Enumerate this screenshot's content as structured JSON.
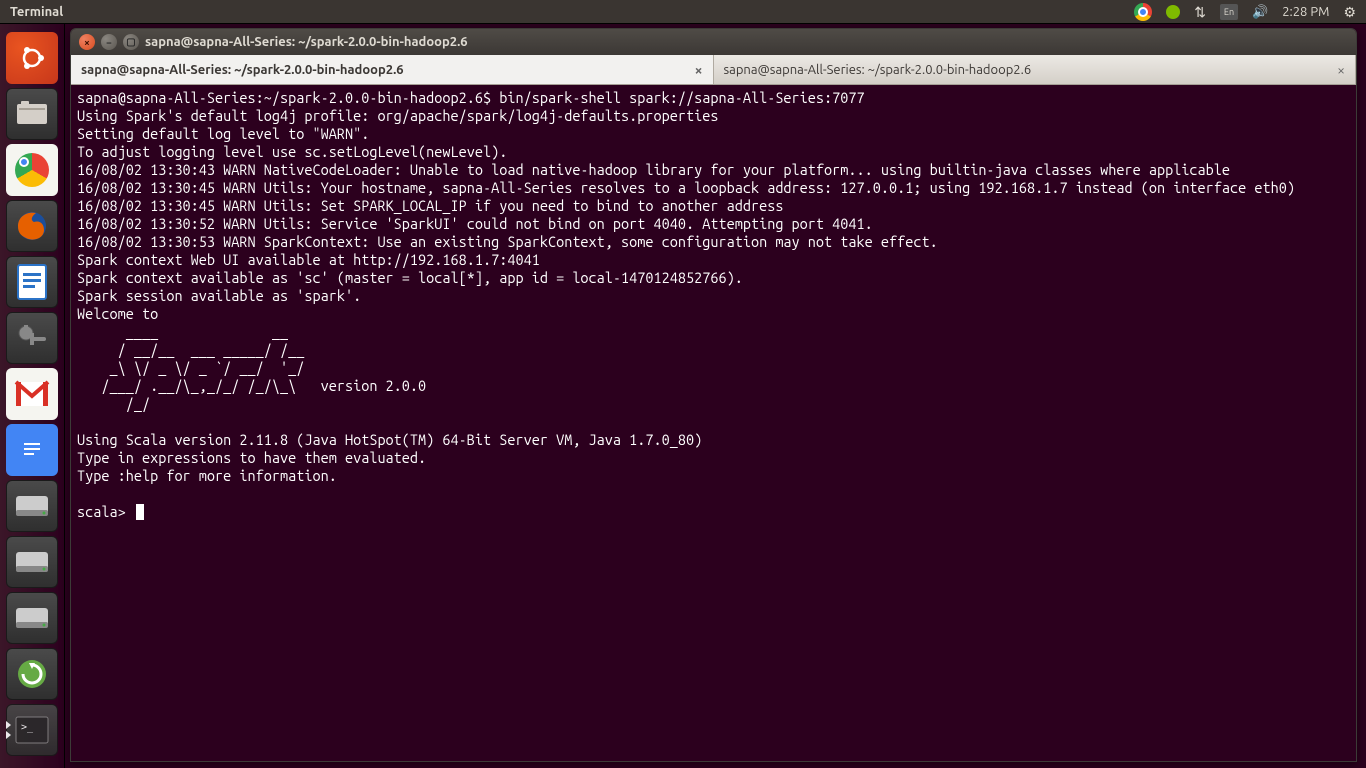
{
  "menubar": {
    "app": "Terminal",
    "kbd": "En",
    "clock": "2:28 PM"
  },
  "window": {
    "title": "sapna@sapna-All-Series: ~/spark-2.0.0-bin-hadoop2.6",
    "tabs": [
      {
        "label": "sapna@sapna-All-Series: ~/spark-2.0.0-bin-hadoop2.6"
      },
      {
        "label": "sapna@sapna-All-Series: ~/spark-2.0.0-bin-hadoop2.6"
      }
    ]
  },
  "terminal": {
    "line0": "sapna@sapna-All-Series:~/spark-2.0.0-bin-hadoop2.6$ bin/spark-shell spark://sapna-All-Series:7077",
    "line1": "Using Spark's default log4j profile: org/apache/spark/log4j-defaults.properties",
    "line2": "Setting default log level to \"WARN\".",
    "line3": "To adjust logging level use sc.setLogLevel(newLevel).",
    "line4": "16/08/02 13:30:43 WARN NativeCodeLoader: Unable to load native-hadoop library for your platform... using builtin-java classes where applicable",
    "line5": "16/08/02 13:30:45 WARN Utils: Your hostname, sapna-All-Series resolves to a loopback address: 127.0.0.1; using 192.168.1.7 instead (on interface eth0)",
    "line6": "16/08/02 13:30:45 WARN Utils: Set SPARK_LOCAL_IP if you need to bind to another address",
    "line7": "16/08/02 13:30:52 WARN Utils: Service 'SparkUI' could not bind on port 4040. Attempting port 4041.",
    "line8": "16/08/02 13:30:53 WARN SparkContext: Use an existing SparkContext, some configuration may not take effect.",
    "line9": "Spark context Web UI available at http://192.168.1.7:4041",
    "line10": "Spark context available as 'sc' (master = local[*], app id = local-1470124852766).",
    "line11": "Spark session available as 'spark'.",
    "line12": "Welcome to",
    "ascii1": "      ____              __",
    "ascii2": "     / __/__  ___ _____/ /__",
    "ascii3": "    _\\ \\/ _ \\/ _ `/ __/  '_/",
    "ascii4": "   /___/ .__/\\_,_/_/ /_/\\_\\   version 2.0.0",
    "ascii5": "      /_/",
    "line13": "",
    "line14": "Using Scala version 2.11.8 (Java HotSpot(TM) 64-Bit Server VM, Java 1.7.0_80)",
    "line15": "Type in expressions to have them evaluated.",
    "line16": "Type :help for more information.",
    "line17": "",
    "prompt": "scala> "
  }
}
